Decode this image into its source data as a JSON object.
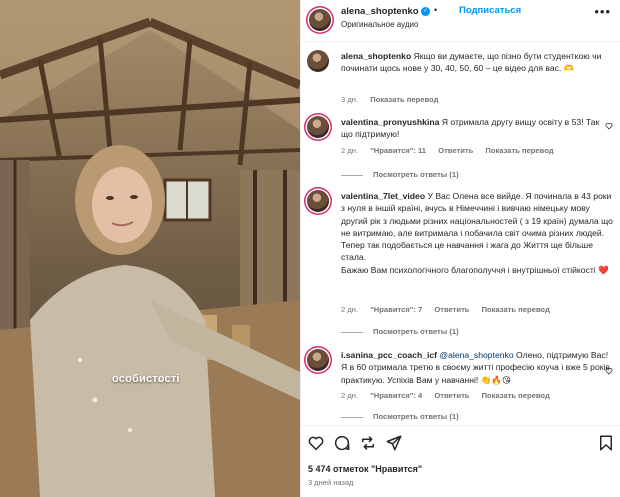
{
  "post_header": {
    "username": "alena_shoptenko",
    "follow_label": "Подписаться",
    "audio_label": "Оригинальное аудио",
    "separator": "•",
    "more_icon": "more-horizontal-icon"
  },
  "media": {
    "caption": "особистості"
  },
  "caption": {
    "username": "alena_shoptenko",
    "text": "Якщо ви думаєте, що пізно бути студенткою чи починати щось нове у 30, 40, 50, 60 – це відео для вас. 🫶",
    "age": "3 дн.",
    "translate_label": "Показать перевод"
  },
  "comments": [
    {
      "username": "valentina_pronyushkina",
      "text": "Я отримала другу вищу освіту в 53! Так що підтримую!",
      "age": "2 дн.",
      "likes": "\"Нравится\": 11",
      "reply_label": "Ответить",
      "translate_label": "Показать перевод",
      "replies_label": "Посмотреть ответы (1)"
    },
    {
      "username": "valentina_7let_video",
      "text": "У Вас Олена все вийде. Я починала в 43 роки з нуля в іншій країні, вчусь в Німеччині і вивчаю німецьку мову другий рік з людьми різних національностей ( з 19 країн) думала що не витримаю, але витримала і побачила світ очима різних людей.\nТепер так подобається це навчання і жага до Життя ще більше стала.\nБажаю Вам психологічного благополуччя і внутрішньої стійкості ❤️",
      "age": "2 дн.",
      "likes": "\"Нравится\": 7",
      "reply_label": "Ответить",
      "translate_label": "Показать перевод",
      "replies_label": "Посмотреть ответы (1)"
    },
    {
      "username": "i.sanina_pcc_coach_icf",
      "mention": "@alena_shoptenko",
      "text": "Олено, підтримую Вас! Я в 60 отримала третю в своєму житті професію коуча і вже 5 років практикую. Успіхів Вам у навчанні! 👏🔥😘",
      "age": "2 дн.",
      "likes": "\"Нравится\": 4",
      "reply_label": "Ответить",
      "translate_label": "Показать перевод",
      "replies_label": "Посмотреть ответы (1)"
    }
  ],
  "footer": {
    "likes": "5 474 отметок \"Нравится\"",
    "date": "3 дней назад"
  },
  "colors": {
    "accent": "#0095f6",
    "secondary_text": "#737373",
    "heart_emoji": "#e0245e"
  }
}
